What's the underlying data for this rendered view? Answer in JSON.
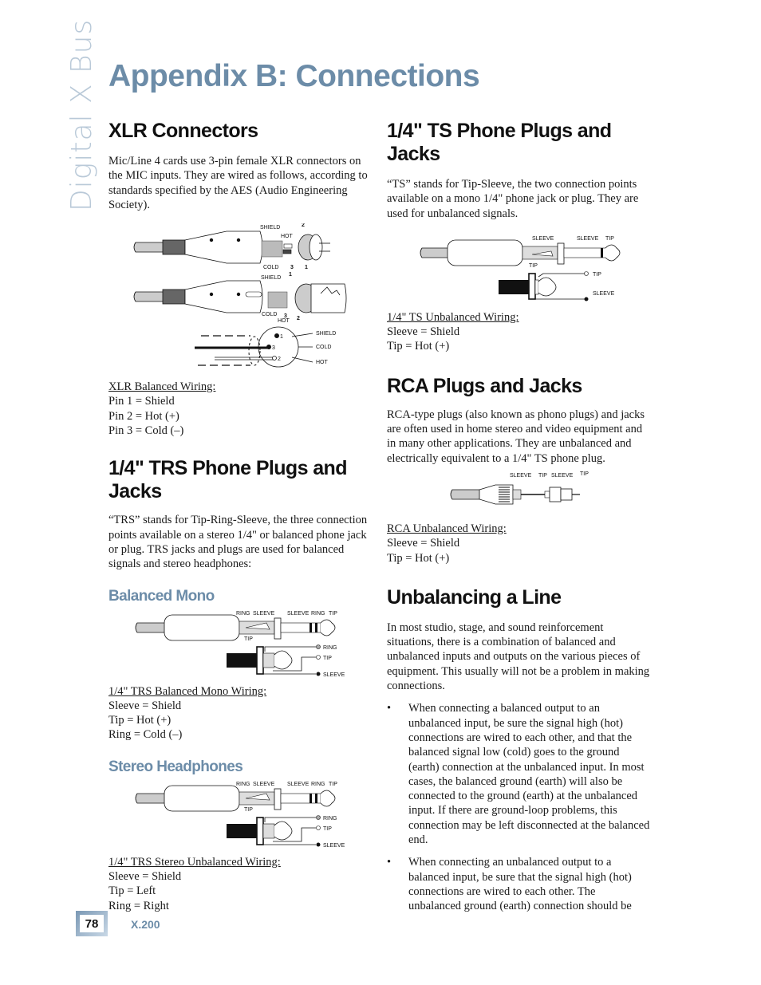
{
  "side_tab": "Digital X Bus",
  "page_title": "Appendix B: Connections",
  "left": {
    "xlr": {
      "heading": "XLR Connectors",
      "body": "Mic/Line 4 cards use 3-pin female XLR connectors on the MIC inputs. They are wired as follows, according to standards specified by the AES (Audio Engineering Society).",
      "diagram_labels": {
        "shield": "SHIELD",
        "hot": "HOT",
        "cold": "COLD",
        "pin1": "1",
        "pin2": "2",
        "pin3": "3"
      },
      "wiring_title": "XLR Balanced Wiring:",
      "wiring_lines": [
        "Pin 1 = Shield",
        "Pin 2 = Hot (+)",
        "Pin 3 = Cold (–)"
      ]
    },
    "trs": {
      "heading": "1/4\" TRS Phone Plugs and Jacks",
      "body": "“TRS” stands for Tip-Ring-Sleeve, the three connection points available on a stereo 1/4\" or balanced phone jack or plug. TRS jacks and plugs are used for balanced signals and stereo headphones:",
      "balanced_mono": {
        "subheading": "Balanced Mono",
        "diagram_labels": {
          "ring": "RING",
          "sleeve": "SLEEVE",
          "tip": "TIP"
        },
        "wiring_title": "1/4\" TRS Balanced Mono Wiring:",
        "wiring_lines": [
          "Sleeve = Shield",
          "Tip = Hot (+)",
          "Ring = Cold (–)"
        ]
      },
      "stereo_headphones": {
        "subheading": "Stereo Headphones",
        "diagram_labels": {
          "ring": "RING",
          "sleeve": "SLEEVE",
          "tip": "TIP"
        },
        "wiring_title": "1/4\" TRS Stereo Unbalanced Wiring:",
        "wiring_lines": [
          "Sleeve = Shield",
          "Tip = Left",
          "Ring = Right"
        ]
      }
    }
  },
  "right": {
    "ts": {
      "heading": "1/4\" TS Phone Plugs and Jacks",
      "body": "“TS” stands for Tip-Sleeve, the two connection points available on a mono 1/4\" phone jack or plug. They are used for unbalanced signals.",
      "diagram_labels": {
        "sleeve": "SLEEVE",
        "tip": "TIP"
      },
      "wiring_title": "1/4\" TS Unbalanced Wiring:",
      "wiring_lines": [
        "Sleeve = Shield",
        "Tip = Hot (+)"
      ]
    },
    "rca": {
      "heading": "RCA Plugs and Jacks",
      "body": "RCA-type plugs (also known as phono plugs) and jacks are often used in home stereo and video equipment and in many other applications. They are unbalanced and electrically equivalent to a 1/4\" TS phone plug.",
      "diagram_labels": {
        "sleeve": "SLEEVE",
        "tip": "TIP"
      },
      "wiring_title": "RCA Unbalanced Wiring:",
      "wiring_lines": [
        "Sleeve = Shield",
        "Tip = Hot (+)"
      ]
    },
    "unbalancing": {
      "heading": "Unbalancing a Line",
      "body": "In most studio, stage, and sound reinforcement situations, there is a combination of balanced and unbalanced inputs and outputs on the various pieces of equipment. This usually will not be a problem in making connections.",
      "bullet_char": "•",
      "bullets": [
        "When connecting a balanced output to an unbalanced input, be sure the signal high (hot) connections are wired to each other, and that the balanced signal low (cold) goes to the ground (earth) connection at the unbalanced input. In most cases, the balanced ground (earth) will also be connected to the ground (earth) at the unbalanced input. If there are ground-loop problems, this connection may be left disconnected at the balanced end.",
        "When connecting an unbalanced output to a balanced input, be sure that the signal high (hot) connections are wired to each other. The unbalanced ground (earth) connection should be"
      ]
    }
  },
  "footer": {
    "page_number": "78",
    "model": "X.200"
  },
  "colors": {
    "accent": "#6c8ca8",
    "side_tab": "#b9c9d8"
  }
}
